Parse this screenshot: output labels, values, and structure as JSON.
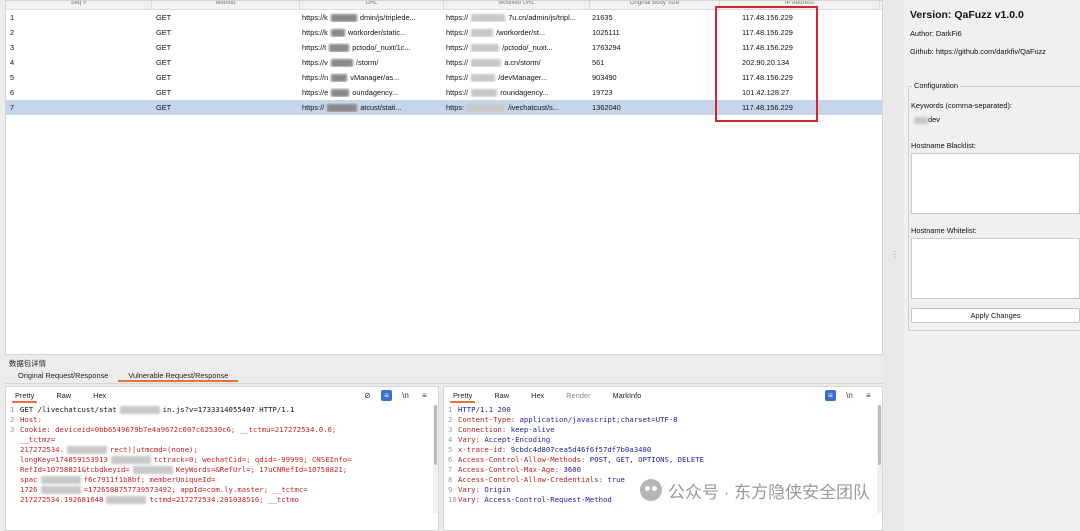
{
  "table": {
    "headers": [
      "Seq #",
      "Method",
      "URL",
      "Modified URL",
      "Original Body Size",
      "IP Address"
    ],
    "rows": [
      {
        "seq": "1",
        "method": "GET",
        "url_a": "https://k",
        "url_b": "dmin/js/triplede...",
        "mod_a": "https://",
        "mod_b": "7u.cn/admin/js/tripl...",
        "size": "21635",
        "ip": "117.48.156.229",
        "selected": false
      },
      {
        "seq": "2",
        "method": "GET",
        "url_a": "https://k",
        "url_b": "workorder/static...",
        "mod_a": "https://",
        "mod_b": "/workorder/st...",
        "size": "1025111",
        "ip": "117.48.156.229",
        "selected": false
      },
      {
        "seq": "3",
        "method": "GET",
        "url_a": "https://t",
        "url_b": "pctodo/_nuxt/1c...",
        "mod_a": "https://",
        "mod_b": "/pctodo/_nuxt...",
        "size": "1763294",
        "ip": "117.48.156.229",
        "selected": false
      },
      {
        "seq": "4",
        "method": "GET",
        "url_a": "https://v",
        "url_b": "/storm/",
        "mod_a": "https://",
        "mod_b": "a.cn/storm/",
        "size": "561",
        "ip": "202.90.20.134",
        "selected": false
      },
      {
        "seq": "5",
        "method": "GET",
        "url_a": "https://n",
        "url_b": "vManager/as...",
        "mod_a": "https://",
        "mod_b": "/devManager...",
        "size": "903490",
        "ip": "117.48.156.229",
        "selected": false
      },
      {
        "seq": "6",
        "method": "GET",
        "url_a": "https://e",
        "url_b": "oundagency...",
        "mod_a": "https://",
        "mod_b": "roundagency...",
        "size": "19723",
        "ip": "101.42.128.27",
        "selected": false
      },
      {
        "seq": "7",
        "method": "GET",
        "url_a": "https://",
        "url_b": "atcust/stati...",
        "mod_a": "https:",
        "mod_b": "/ivechatcust/s...",
        "size": "1362040",
        "ip": "117.48.156.229",
        "selected": true
      }
    ]
  },
  "detail": {
    "title": "数据包详情",
    "tabs": [
      "Original Request/Response",
      "Vulnerable Request/Response"
    ],
    "active_tab": "Vulnerable Request/Response"
  },
  "request": {
    "tabs": [
      "Pretty",
      "Raw",
      "Hex"
    ],
    "lines": [
      {
        "n": "1",
        "text": "GET /livechatcust/stat",
        "tail": "in.js?v=1733314055407 HTTP/1.1"
      },
      {
        "n": "2",
        "key": "Host:",
        "text": " "
      },
      {
        "n": "3",
        "key": "Cookie:",
        "text": " deviceid=0bb6549679b7e4a9672c007c62530c6; __tctmu=217272534.0.0;"
      },
      {
        "n": "",
        "key": "",
        "text": "__tctmz="
      },
      {
        "n": "",
        "key": "",
        "text": "217272534.",
        "tail": "rect)|utmcmd=(none);"
      },
      {
        "n": "",
        "key": "",
        "text": "longKey=174859153913",
        "tail": "tctrack=0; wechatCid=; qdid=-99999; CNSEInfo="
      },
      {
        "n": "",
        "key": "",
        "text": "RefId=10758821&tcbdkeyid=",
        "tail": "KeyWords=&RefUrl=; 17uCNRefId=10758821;"
      },
      {
        "n": "",
        "key": "",
        "text": "spac",
        "tail": "f6c7911f1b8bf; memberUniqueId="
      },
      {
        "n": "",
        "key": "",
        "text": "1726",
        "tail": "=172658875773957349­2; appId=com.ly.master; __tctmc="
      },
      {
        "n": "",
        "key": "",
        "text": "217272534.192681648",
        "tail": "tctmd=217272534.201038516; __tctmo"
      }
    ]
  },
  "response": {
    "tabs": [
      "Pretty",
      "Raw",
      "Hex",
      "Render",
      "MarkInfo"
    ],
    "lines": [
      {
        "n": "1",
        "key": "",
        "text": "HTTP/1.1 200"
      },
      {
        "n": "2",
        "key": "Content-Type:",
        "text": " application/javascript;charset=UTF-8"
      },
      {
        "n": "3",
        "key": "Connection:",
        "text": " keep-alive"
      },
      {
        "n": "4",
        "key": "Vary:",
        "text": " Accept-Encoding"
      },
      {
        "n": "5",
        "key": "x-trace-id:",
        "text": " 9cbdc4d807cea5d46f6f57df7b0a3480"
      },
      {
        "n": "6",
        "key": "Access-Control-Allow-Methods:",
        "text": " POST, GET, OPTIONS, DELETE"
      },
      {
        "n": "7",
        "key": "Access-Control-Max-Age:",
        "text": " 3600"
      },
      {
        "n": "8",
        "key": "Access-Control-Allow-Credentials:",
        "text": " true"
      },
      {
        "n": "9",
        "key": "Vary:",
        "text": " Origin"
      },
      {
        "n": "10",
        "key": "Vary:",
        "text": " Access-Control-Request-Method"
      }
    ]
  },
  "plugin": {
    "version": "Version: QaFuzz v1.0.0",
    "author": "Author: DarkFi6",
    "github": "Github: https://github.com/darkfiv/QaFuzz",
    "config_label": "Configuration",
    "keywords_label": "Keywords (comma-separated):",
    "keywords_value": "dev",
    "blacklist_label": "Hostname Blacklist:",
    "whitelist_label": "Hostname Whitelist:",
    "apply_label": "Apply Changes"
  },
  "watermark": "公众号 · 东方隐侠安全团队",
  "colors": {
    "highlight": "#d9232e",
    "selected_row": "#c7d5ea",
    "active_tab": "#e5733b"
  }
}
